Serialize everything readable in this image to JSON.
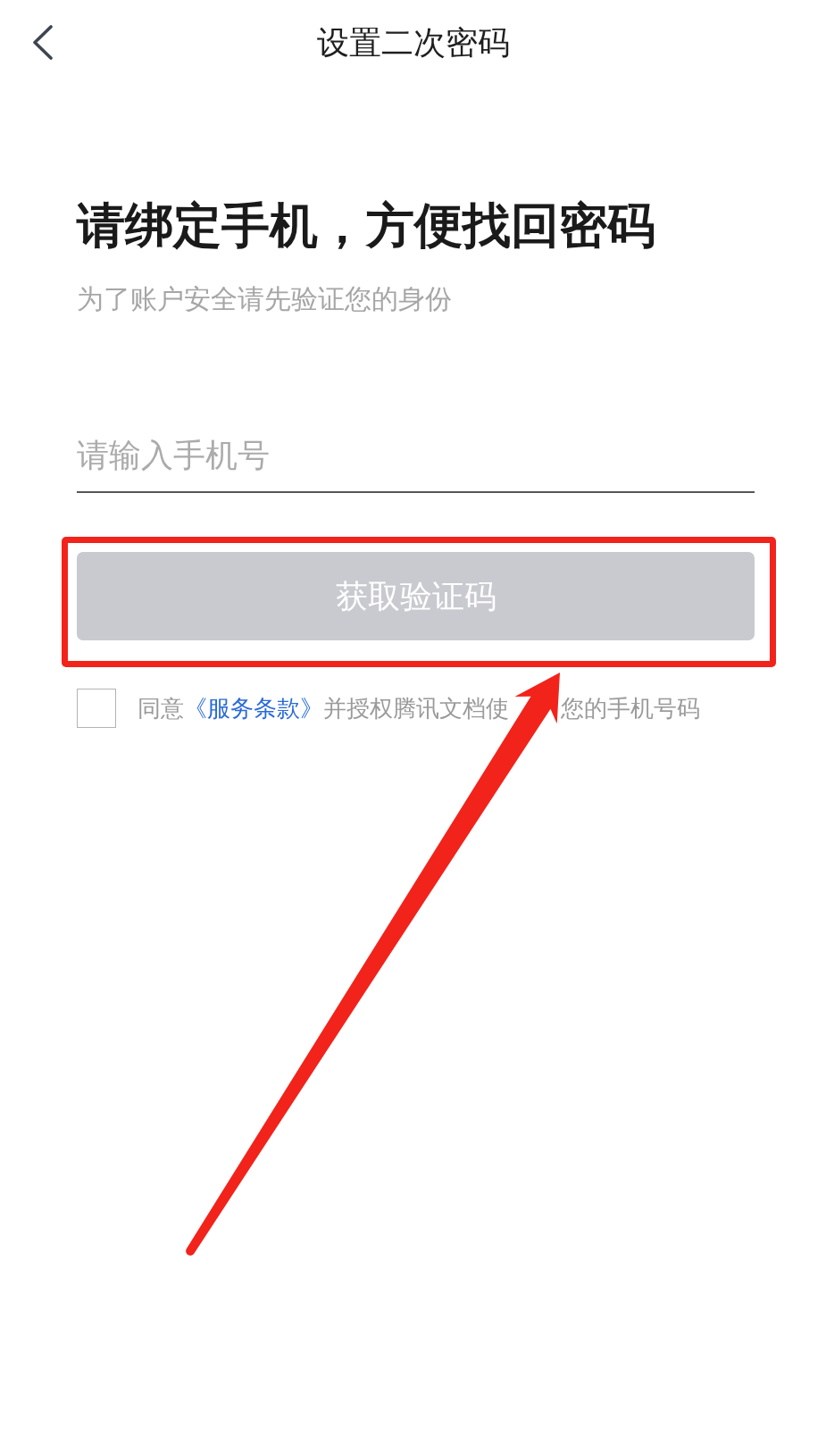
{
  "nav": {
    "title": "设置二次密码"
  },
  "heading": "请绑定手机，方便找回密码",
  "subheading": "为了账户安全请先验证您的身份",
  "phone_field": {
    "placeholder": "请输入手机号"
  },
  "code_button": {
    "label": "获取验证码",
    "disabled": true,
    "highlighted": true
  },
  "consent": {
    "checked": false,
    "text": "同意",
    "link": "《服务条款》",
    "text_after_link": [
      "并授权腾讯文档使",
      "您的手机号码"
    ]
  }
}
